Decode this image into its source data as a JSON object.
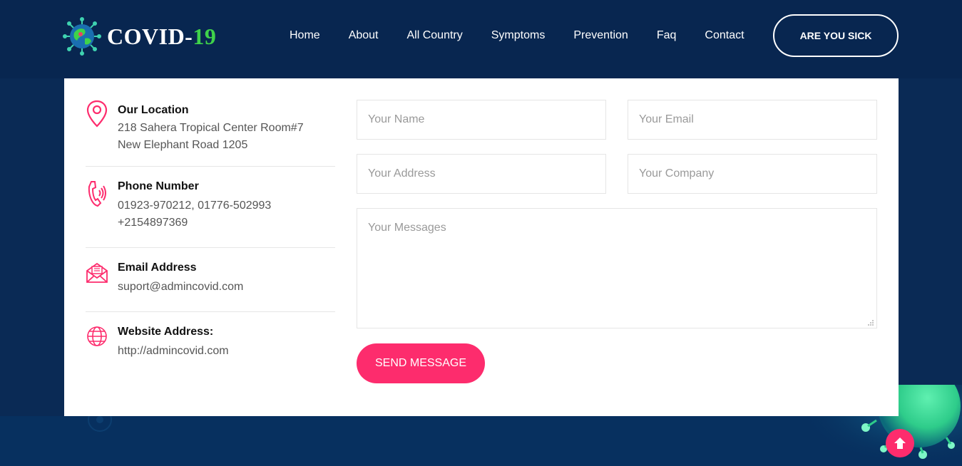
{
  "brand": {
    "name_main": "COVID-",
    "name_accent": "19",
    "accent_color": "#3fd24a"
  },
  "nav": {
    "items": [
      {
        "label": "Home"
      },
      {
        "label": "About"
      },
      {
        "label": "All Country"
      },
      {
        "label": "Symptoms"
      },
      {
        "label": "Prevention"
      },
      {
        "label": "Faq"
      },
      {
        "label": "Contact"
      }
    ],
    "cta_label": "ARE YOU SICK"
  },
  "contact_info": {
    "location": {
      "title": "Our Location",
      "lines": [
        "218 Sahera Tropical Center Room#7",
        "New Elephant Road 1205"
      ],
      "icon": "map-pin-icon"
    },
    "phone": {
      "title": "Phone Number",
      "lines": [
        "01923-970212, 01776-502993",
        "+2154897369"
      ],
      "icon": "phone-icon"
    },
    "email": {
      "title": "Email Address",
      "lines": [
        "suport@admincovid.com"
      ],
      "icon": "envelope-icon"
    },
    "website": {
      "title": "Website Address:",
      "lines": [
        "http://admincovid.com"
      ],
      "icon": "globe-icon"
    }
  },
  "form": {
    "name_placeholder": "Your Name",
    "email_placeholder": "Your Email",
    "address_placeholder": "Your Address",
    "company_placeholder": "Your Company",
    "message_placeholder": "Your Messages",
    "submit_label": "SEND MESSAGE"
  },
  "colors": {
    "header_bg": "#082650",
    "page_bg": "#0a2a55",
    "primary_pink": "#fd2c6d",
    "card_bg": "#ffffff"
  }
}
